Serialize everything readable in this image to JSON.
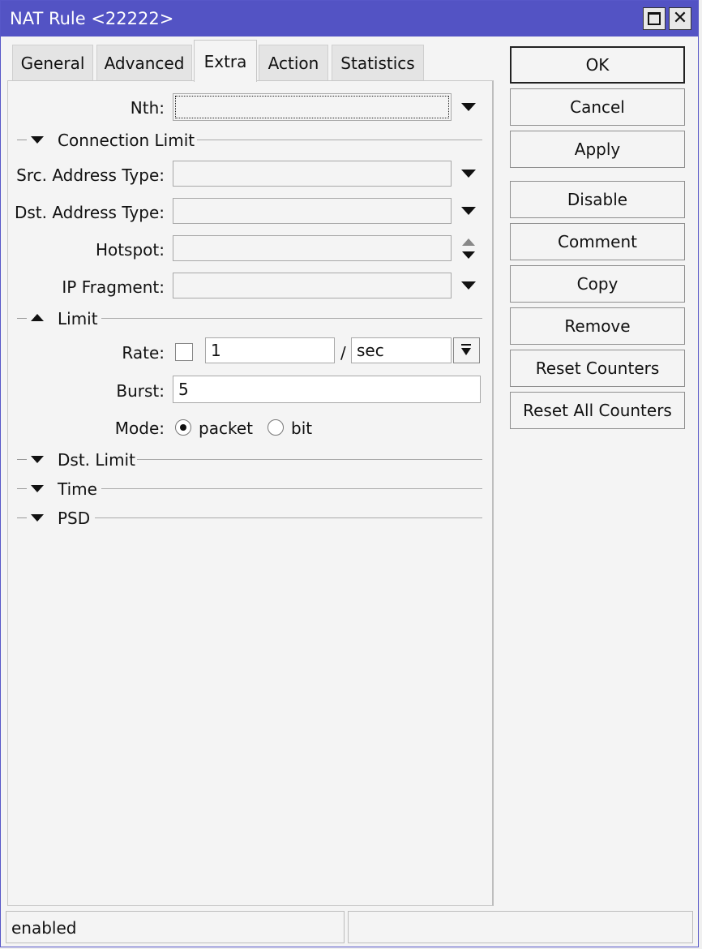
{
  "window": {
    "title": "NAT Rule <22222>"
  },
  "tabs": [
    {
      "label": "General"
    },
    {
      "label": "Advanced"
    },
    {
      "label": "Extra"
    },
    {
      "label": "Action"
    },
    {
      "label": "Statistics"
    }
  ],
  "active_tab": "Extra",
  "fields": {
    "nth": {
      "label": "Nth:",
      "value": ""
    },
    "src_address_type": {
      "label": "Src. Address Type:",
      "value": ""
    },
    "dst_address_type": {
      "label": "Dst. Address Type:",
      "value": ""
    },
    "hotspot": {
      "label": "Hotspot:",
      "value": ""
    },
    "ip_fragment": {
      "label": "IP Fragment:",
      "value": ""
    }
  },
  "sections": {
    "connection_limit": "Connection Limit",
    "limit": "Limit",
    "dst_limit": "Dst. Limit",
    "time": "Time",
    "psd": "PSD"
  },
  "limit": {
    "rate_label": "Rate:",
    "rate_value": "1",
    "rate_separator": "/",
    "rate_unit": "sec",
    "burst_label": "Burst:",
    "burst_value": "5",
    "mode_label": "Mode:",
    "mode_options": [
      "packet",
      "bit"
    ],
    "mode_selected": "packet"
  },
  "buttons": {
    "ok": "OK",
    "cancel": "Cancel",
    "apply": "Apply",
    "disable": "Disable",
    "comment": "Comment",
    "copy": "Copy",
    "remove": "Remove",
    "reset_counters": "Reset Counters",
    "reset_all_counters": "Reset All Counters"
  },
  "status": {
    "left": "enabled",
    "right": ""
  },
  "colors": {
    "titlebar": "#5353c4",
    "background": "#f4f4f4"
  }
}
